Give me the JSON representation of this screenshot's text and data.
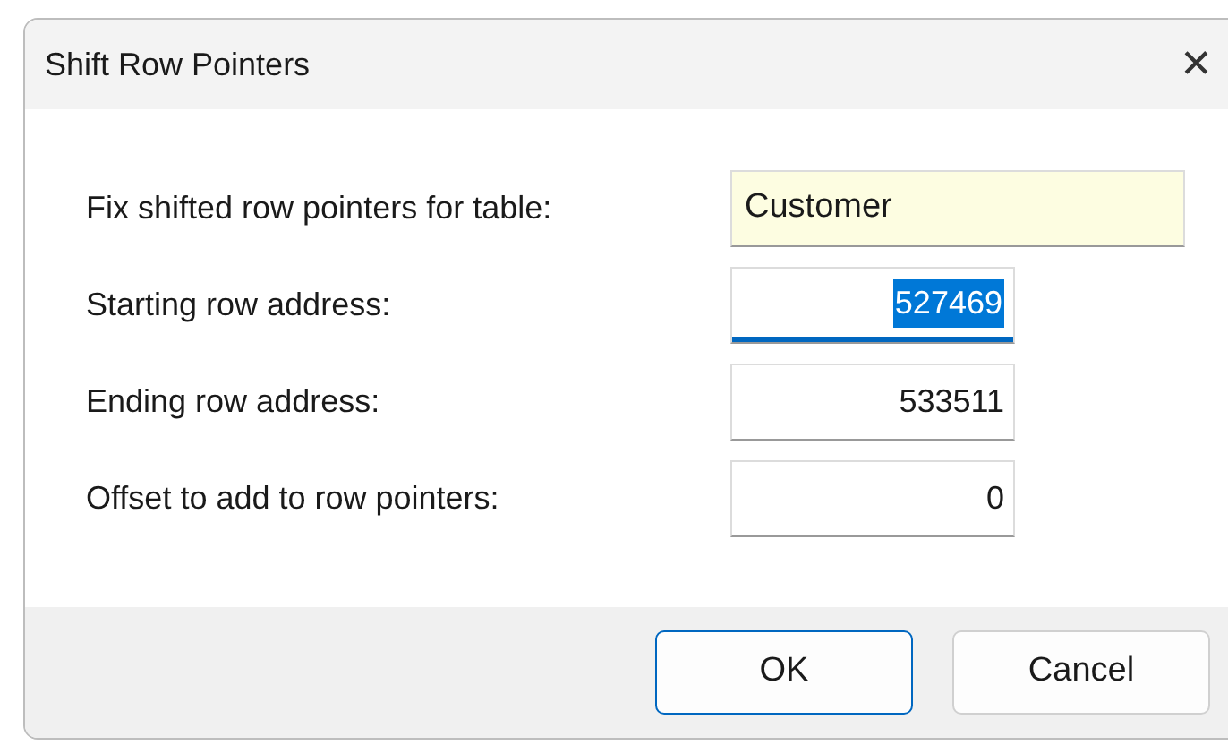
{
  "window": {
    "title": "Shift Row Pointers",
    "close": "✕"
  },
  "fields": [
    {
      "label": "Fix shifted row pointers for table:",
      "value": "Customer",
      "kind": "readonly"
    },
    {
      "label": "Starting row address:",
      "value": "527469",
      "kind": "number",
      "focused": true
    },
    {
      "label": "Ending row address:",
      "value": "533511",
      "kind": "number",
      "focused": false
    },
    {
      "label": "Offset to add to row pointers:",
      "value": "0",
      "kind": "number",
      "focused": false
    }
  ],
  "buttons": [
    {
      "label": "OK",
      "default": true
    },
    {
      "label": "Cancel",
      "default": false
    }
  ]
}
